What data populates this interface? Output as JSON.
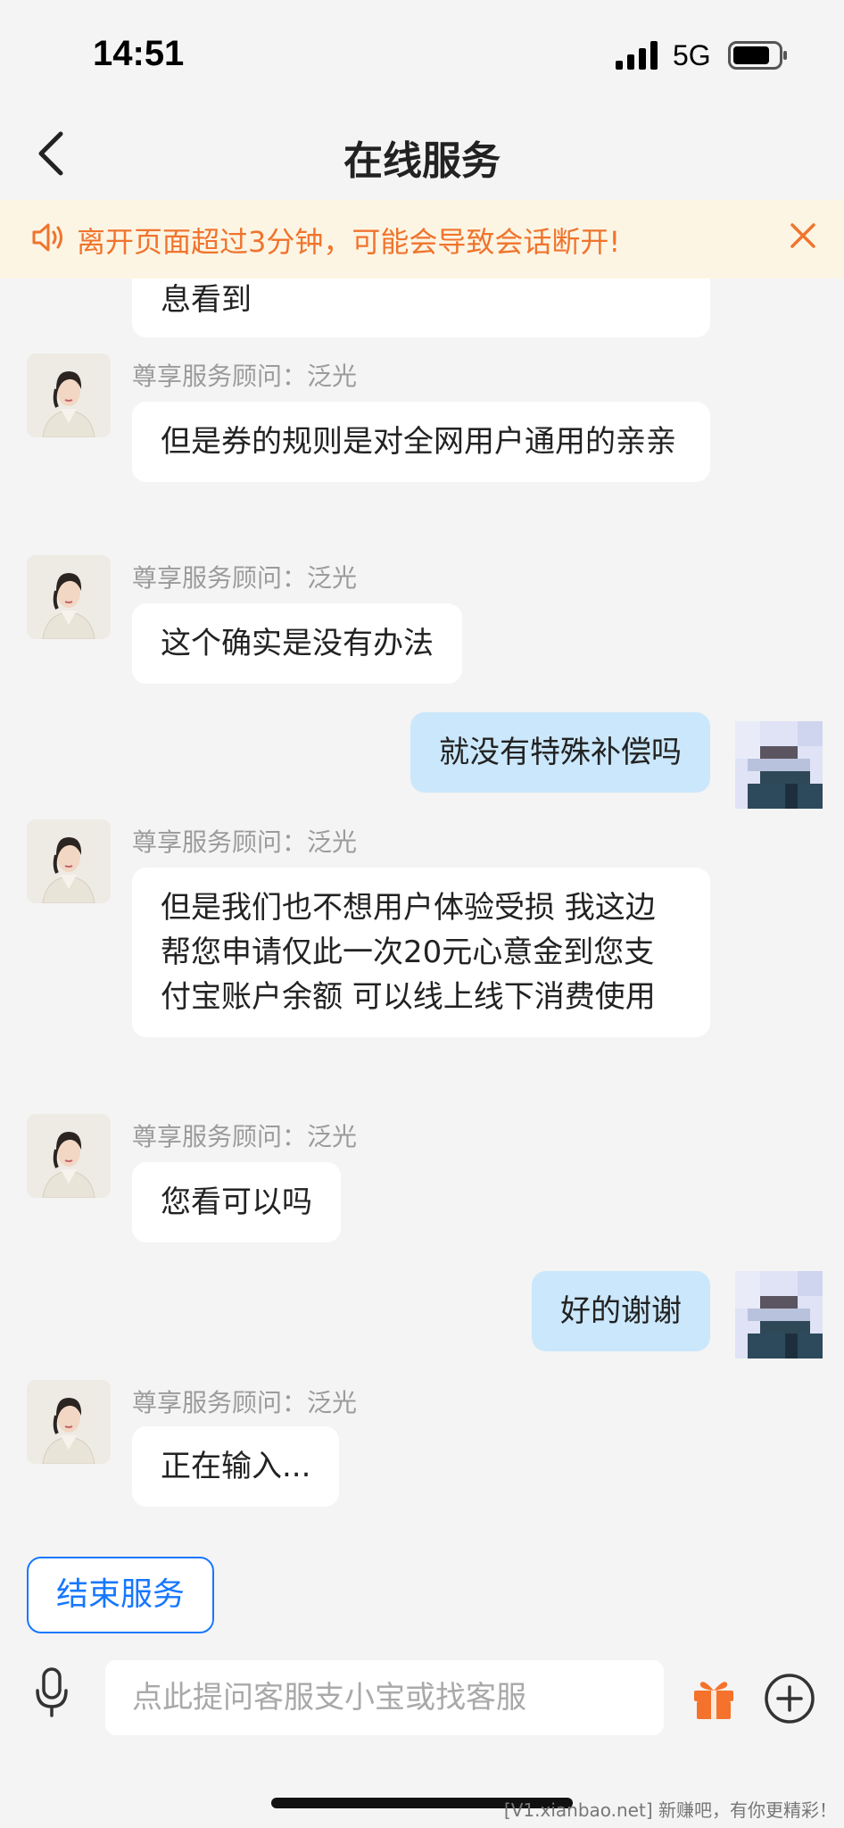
{
  "status_bar": {
    "time": "14:51",
    "network": "5G"
  },
  "nav": {
    "title": "在线服务"
  },
  "notice": {
    "text": "离开页面超过3分钟，可能会导致会话断开!"
  },
  "messages": [
    {
      "from": "agent",
      "name": "",
      "text": "息看到"
    },
    {
      "from": "agent",
      "name": "尊享服务顾问：泛光",
      "text": "但是券的规则是对全网用户通用的亲亲"
    },
    {
      "from": "agent",
      "name": "尊享服务顾问：泛光",
      "text": "这个确实是没有办法"
    },
    {
      "from": "user",
      "text": "就没有特殊补偿吗"
    },
    {
      "from": "agent",
      "name": "尊享服务顾问：泛光",
      "text": "但是我们也不想用户体验受损 我这边帮您申请仅此一次20元心意金到您支付宝账户余额 可以线上线下消费使用"
    },
    {
      "from": "agent",
      "name": "尊享服务顾问：泛光",
      "text": "您看可以吗"
    },
    {
      "from": "user",
      "text": "好的谢谢"
    },
    {
      "from": "agent",
      "name": "尊享服务顾问：泛光",
      "text": "正在输入..."
    }
  ],
  "end_service": {
    "label": "结束服务"
  },
  "input": {
    "placeholder": "点此提问客服支小宝或找客服"
  },
  "watermark": "[V1.xianbao.net] 新赚吧，有你更精彩！",
  "icons": {
    "back": "chevron-left-icon",
    "notice": "speaker-icon",
    "close": "close-icon",
    "mic": "microphone-icon",
    "gift": "gift-icon",
    "plus": "plus-circle-icon"
  },
  "colors": {
    "accent": "#1677ff",
    "notice_text": "#f0742d",
    "notice_bg": "#fdf5e4",
    "user_bubble": "#cbe7fb"
  }
}
